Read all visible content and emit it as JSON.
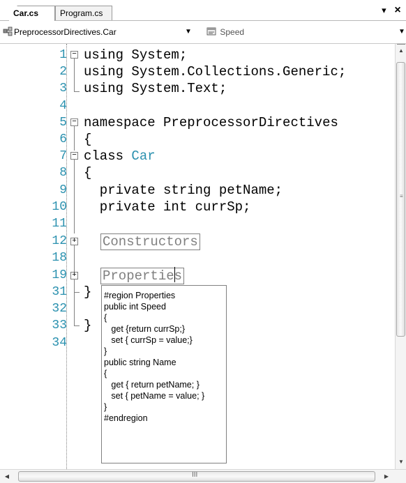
{
  "tabs": [
    {
      "label": "Car.cs",
      "active": true
    },
    {
      "label": "Program.cs",
      "active": false
    }
  ],
  "tab_controls": {
    "dropdown_icon": "chevron-down-icon",
    "close_icon": "close-icon",
    "close_label": "×",
    "dropdown_label": "▾"
  },
  "navbar": {
    "type_combo": {
      "value": "PreprocessorDirectives.Car",
      "icon": "class-icon"
    },
    "member_combo": {
      "value": "Speed",
      "icon": "property-icon"
    }
  },
  "line_numbers": [
    "1",
    "2",
    "3",
    "4",
    "5",
    "6",
    "7",
    "8",
    "9",
    "10",
    "11",
    "12",
    "18",
    "19",
    "31",
    "32",
    "33",
    "34"
  ],
  "code": {
    "l1": "using System;",
    "l2": "using System.Collections.Generic;",
    "l3": "using System.Text;",
    "l5_kw": "namespace",
    "l5_name": " PreprocessorDirectives",
    "l6": "{",
    "l7_kw": "class",
    "l7_name": "Car",
    "l8": "{",
    "l9": "  private string petName;",
    "l10": "  private int currSp;",
    "l12_region": "Constructors",
    "l19_region": "Properties",
    "l31": "}",
    "l33": "}"
  },
  "tooltip": {
    "lines": [
      "#region Properties",
      "public int Speed",
      "{",
      "   get {return currSp;}",
      "   set { currSp = value;}",
      "}",
      "public string Name",
      "{",
      "   get { return petName; }",
      "   set { petName = value; }",
      "}",
      "#endregion"
    ]
  },
  "scrollbars": {
    "hscroll_grip": "III"
  },
  "colors": {
    "line_number": "#2b91af",
    "type_name": "#2b91af",
    "collapsed_region": "#808080"
  }
}
